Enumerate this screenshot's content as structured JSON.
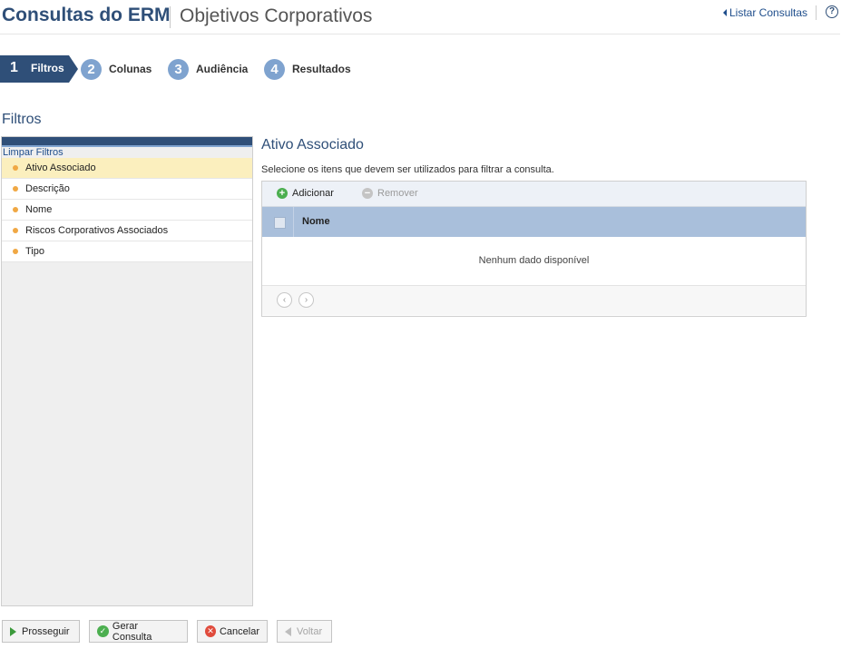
{
  "header": {
    "title": "Consultas do ERM",
    "subtitle": "Objetivos Corporativos",
    "list_link": "Listar Consultas",
    "help_glyph": "?"
  },
  "steps": [
    {
      "number": "1",
      "label": "Filtros",
      "active": true
    },
    {
      "number": "2",
      "label": "Colunas",
      "active": false
    },
    {
      "number": "3",
      "label": "Audiência",
      "active": false
    },
    {
      "number": "4",
      "label": "Resultados",
      "active": false
    }
  ],
  "section_title": "Filtros",
  "filters": {
    "clear_link": "Limpar Filtros",
    "items": [
      {
        "label": "Ativo Associado",
        "selected": true
      },
      {
        "label": "Descrição",
        "selected": false
      },
      {
        "label": "Nome",
        "selected": false
      },
      {
        "label": "Riscos Corporativos Associados",
        "selected": false
      },
      {
        "label": "Tipo",
        "selected": false
      }
    ]
  },
  "panel": {
    "title": "Ativo Associado",
    "description": "Selecione os itens que devem ser utilizados para filtrar a consulta.",
    "toolbar": {
      "add_label": "Adicionar",
      "remove_label": "Remover",
      "add_glyph": "+",
      "remove_glyph": "−"
    },
    "grid": {
      "column_header": "Nome",
      "empty_message": "Nenhum dado disponível",
      "prev_glyph": "‹",
      "next_glyph": "›"
    }
  },
  "buttons": {
    "proceed": "Prosseguir",
    "generate": "Gerar Consulta",
    "cancel": "Cancelar",
    "back": "Voltar",
    "check_glyph": "✓",
    "x_glyph": "✕"
  },
  "colors": {
    "brand_dark": "#2f4f78",
    "step_circle": "#7fa3cf",
    "selected_row": "#fbefbe",
    "grid_header": "#a9bfdb",
    "bullet": "#f0a844"
  }
}
